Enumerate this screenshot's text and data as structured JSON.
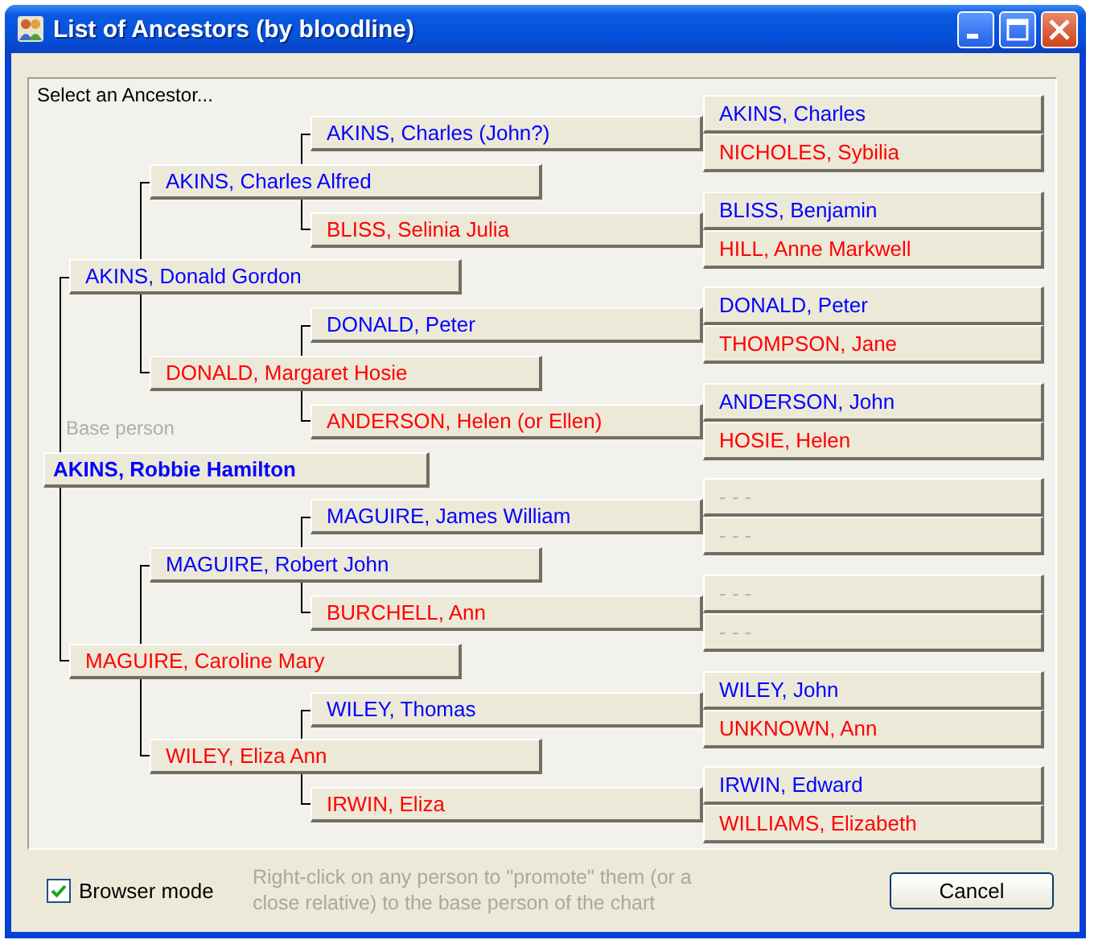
{
  "window": {
    "title": "List of Ancestors (by bloodline)"
  },
  "chart": {
    "prompt": "Select an Ancestor...",
    "base_label": "Base person",
    "root": {
      "name": "AKINS, Robbie Hamilton",
      "color": "#0000ff",
      "parents": [
        {
          "name": "AKINS, Donald Gordon",
          "color": "#0000ff",
          "parents": [
            {
              "name": "AKINS, Charles Alfred",
              "color": "#0000ff",
              "parents": [
                {
                  "name": "AKINS, Charles (John?)",
                  "color": "#0000ff",
                  "parents": [
                    {
                      "name": "AKINS, Charles",
                      "color": "#0000ff"
                    },
                    {
                      "name": "NICHOLES, Sybilia",
                      "color": "#ff0000"
                    }
                  ]
                },
                {
                  "name": "BLISS, Selinia Julia",
                  "color": "#ff0000",
                  "parents": [
                    {
                      "name": "BLISS, Benjamin",
                      "color": "#0000ff"
                    },
                    {
                      "name": "HILL, Anne Markwell",
                      "color": "#ff0000"
                    }
                  ]
                }
              ]
            },
            {
              "name": "DONALD, Margaret Hosie",
              "color": "#ff0000",
              "parents": [
                {
                  "name": "DONALD, Peter",
                  "color": "#0000ff",
                  "parents": [
                    {
                      "name": "DONALD, Peter",
                      "color": "#0000ff"
                    },
                    {
                      "name": "THOMPSON, Jane",
                      "color": "#ff0000"
                    }
                  ]
                },
                {
                  "name": "ANDERSON, Helen (or Ellen)",
                  "color": "#ff0000",
                  "parents": [
                    {
                      "name": "ANDERSON, John",
                      "color": "#0000ff"
                    },
                    {
                      "name": "HOSIE, Helen",
                      "color": "#ff0000"
                    }
                  ]
                }
              ]
            }
          ]
        },
        {
          "name": "MAGUIRE, Caroline Mary",
          "color": "#ff0000",
          "parents": [
            {
              "name": "MAGUIRE, Robert John",
              "color": "#0000ff",
              "parents": [
                {
                  "name": "MAGUIRE, James William",
                  "color": "#0000ff",
                  "parents": [
                    {
                      "name": "- - -",
                      "color": "#b8b4a4"
                    },
                    {
                      "name": "- - -",
                      "color": "#b8b4a4"
                    }
                  ]
                },
                {
                  "name": "BURCHELL, Ann",
                  "color": "#ff0000",
                  "parents": [
                    {
                      "name": "- - -",
                      "color": "#b8b4a4"
                    },
                    {
                      "name": "- - -",
                      "color": "#b8b4a4"
                    }
                  ]
                }
              ]
            },
            {
              "name": "WILEY, Eliza Ann",
              "color": "#ff0000",
              "parents": [
                {
                  "name": "WILEY, Thomas",
                  "color": "#0000ff",
                  "parents": [
                    {
                      "name": "WILEY, John",
                      "color": "#0000ff"
                    },
                    {
                      "name": "UNKNOWN, Ann",
                      "color": "#ff0000"
                    }
                  ]
                },
                {
                  "name": "IRWIN, Eliza",
                  "color": "#ff0000",
                  "parents": [
                    {
                      "name": "IRWIN, Edward",
                      "color": "#0000ff"
                    },
                    {
                      "name": "WILLIAMS, Elizabeth",
                      "color": "#ff0000"
                    }
                  ]
                }
              ]
            }
          ]
        }
      ]
    }
  },
  "footer": {
    "browser_mode": {
      "label": "Browser mode",
      "checked": true
    },
    "hint": "Right-click on any person to \"promote\" them (or a close relative) to the base person of the chart",
    "cancel": "Cancel"
  }
}
